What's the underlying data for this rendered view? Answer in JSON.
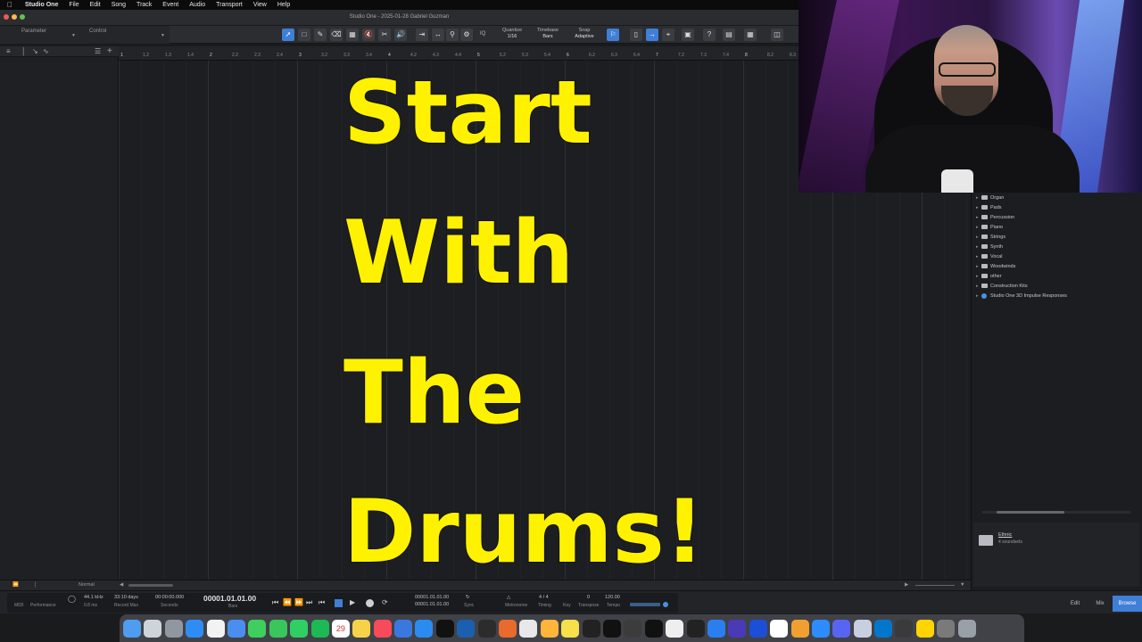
{
  "menubar": {
    "items": [
      "Studio One",
      "File",
      "Edit",
      "Song",
      "Track",
      "Event",
      "Audio",
      "Transport",
      "View",
      "Help"
    ]
  },
  "window": {
    "title": "Studio One - 2025-01-28 Gabriel Guzman"
  },
  "inspector": {
    "parameter_label": "Parameter",
    "control_label": "Control"
  },
  "toolbar": {
    "iq_label": "IQ",
    "quantize": {
      "label": "Quantize",
      "value": "1/16"
    },
    "timebase": {
      "label": "Timebase",
      "value": "Bars"
    },
    "snap": {
      "label": "Snap",
      "value": "Adaptive"
    },
    "help_label": "?",
    "active_tool": "arrow"
  },
  "ruler": {
    "ticks": [
      "1",
      "1.2",
      "1.3",
      "1.4",
      "2",
      "2.2",
      "2.3",
      "2.4",
      "3",
      "3.2",
      "3.3",
      "3.4",
      "4",
      "4.2",
      "4.3",
      "4.4",
      "5",
      "5.2",
      "5.3",
      "5.4",
      "6",
      "6.2",
      "6.3",
      "6.4",
      "7",
      "7.2",
      "7.3",
      "7.4",
      "8",
      "8.2",
      "8.3"
    ]
  },
  "bottombar": {
    "mode_label": "Normal"
  },
  "browser": {
    "items": [
      {
        "label": "Organ",
        "type": "folder"
      },
      {
        "label": "Pads",
        "type": "folder"
      },
      {
        "label": "Percussion",
        "type": "folder"
      },
      {
        "label": "Piano",
        "type": "folder"
      },
      {
        "label": "Strings",
        "type": "folder"
      },
      {
        "label": "Synth",
        "type": "folder"
      },
      {
        "label": "Vocal",
        "type": "folder"
      },
      {
        "label": "Woodwinds",
        "type": "folder"
      },
      {
        "label": "other",
        "type": "folder"
      },
      {
        "label": "Construction Kits",
        "type": "folder"
      },
      {
        "label": "Studio One 3D Impulse Responses",
        "type": "sphere"
      }
    ],
    "info": {
      "name": "Ethnic",
      "subtitle": "4 soundsets"
    }
  },
  "transport": {
    "midi_label": "MIDI",
    "performance_label": "Performance",
    "sample_rate": "44.1 kHz",
    "latency": "0.8 ms",
    "record_max_value": "33:10 days",
    "record_max_label": "Record Max",
    "seconds_value": "00:00:00.000",
    "seconds_label": "Seconds",
    "position": "00001.01.01.00",
    "position_label": "Bars",
    "loop_start": "00001.01.01.00",
    "loop_end": "00001.01.01.00",
    "sync_label": "Sync",
    "metronome_label": "Metronome",
    "timing_value": "4 / 4",
    "timing_label": "Timing",
    "key_label": "Key",
    "transpose_value": "0",
    "transpose_label": "Transpose",
    "tempo_value": "120.00",
    "tempo_label": "Tempo"
  },
  "pages": {
    "edit": "Edit",
    "mix": "Mix",
    "browse": "Browse",
    "active": "Browse"
  },
  "overlay": {
    "line1": "Start",
    "line2": "With",
    "line3": "The",
    "line4": "Drums!"
  },
  "colors": {
    "accent": "#3f7fd6",
    "overlay_text": "#fff200"
  },
  "dock": {
    "icons": [
      "finder-icon",
      "launchpad-icon",
      "settings-icon",
      "safari-icon",
      "chrome-icon",
      "mail-icon",
      "messages-icon",
      "facetime-icon",
      "whatsapp-icon",
      "spotify-icon",
      "calendar-icon",
      "notes-icon",
      "music-icon",
      "keynote-icon",
      "appstore-icon",
      "capcut-icon",
      "studio-one-icon",
      "obs-icon",
      "screenflow-icon",
      "activity-icon",
      "sublime-icon",
      "nectar-icon",
      "logic-icon",
      "ableton-icon",
      "kontakt-icon",
      "native-access-icon",
      "notion-icon",
      "rode-icon",
      "xcode-icon",
      "visual-studio-icon",
      "serato-icon",
      "notion-app-icon",
      "gfx-icon",
      "zoom-icon",
      "discord-icon",
      "preview-icon",
      "wavesfactory-icon",
      "quicktime-icon",
      "miro-icon",
      "screenshot-icon",
      "trash-icon"
    ],
    "calendar_date": "29"
  }
}
